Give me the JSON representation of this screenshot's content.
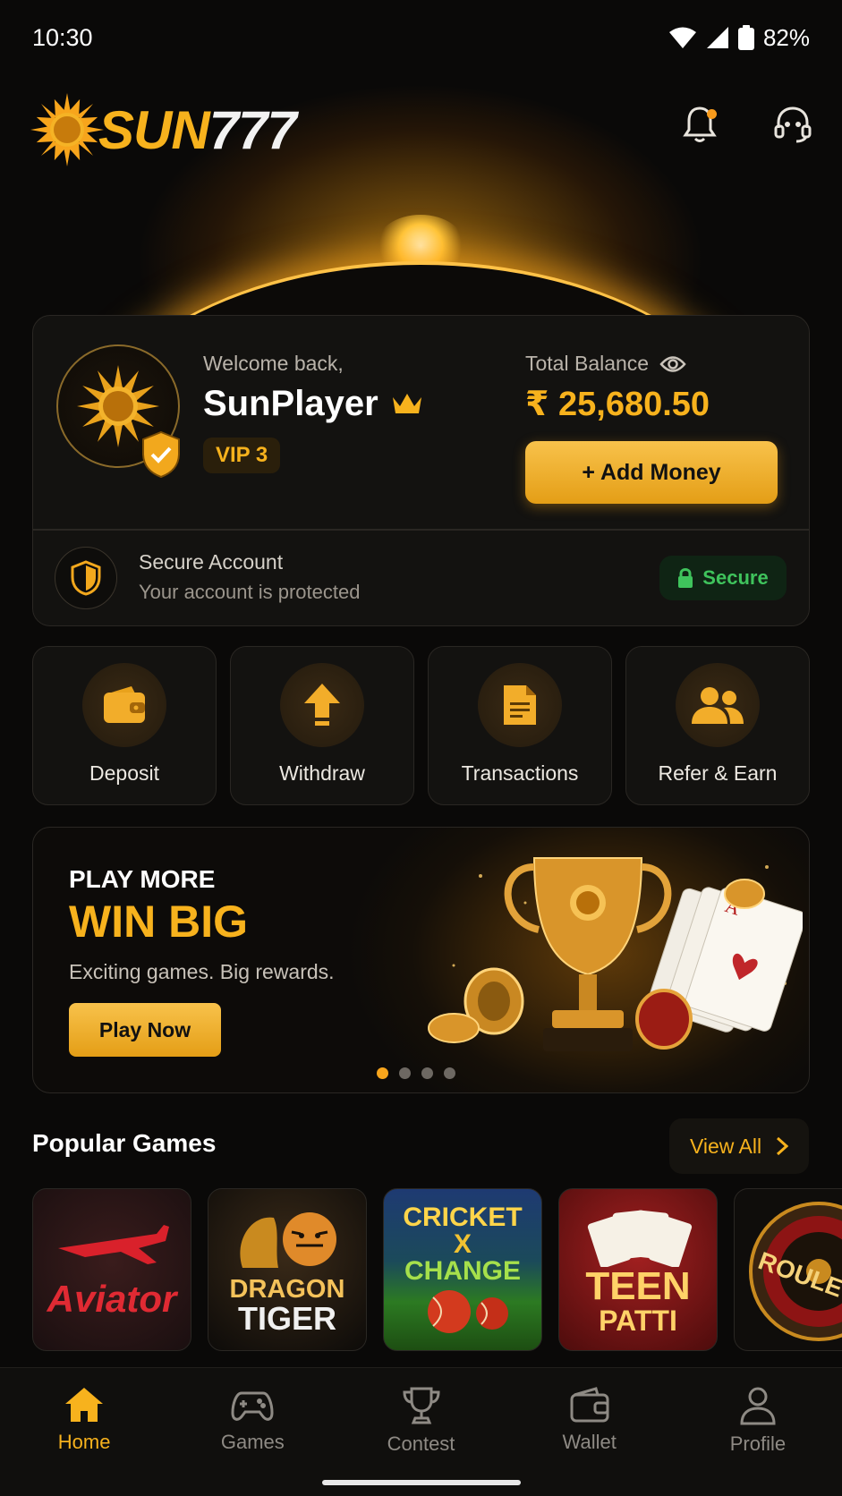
{
  "status_bar": {
    "time": "10:30",
    "battery": "82%"
  },
  "brand": {
    "name_part1": "SUN",
    "name_part2": "777"
  },
  "account": {
    "welcome": "Welcome back,",
    "username": "SunPlayer",
    "vip": "VIP 3",
    "balance_label": "Total Balance",
    "balance": "₹ 25,680.50",
    "add_money": "+ Add Money"
  },
  "security": {
    "title": "Secure Account",
    "subtitle": "Your account is protected",
    "badge": "Secure"
  },
  "quick_actions": [
    {
      "label": "Deposit",
      "icon": "wallet-icon"
    },
    {
      "label": "Withdraw",
      "icon": "arrow-up-icon"
    },
    {
      "label": "Transactions",
      "icon": "document-icon"
    },
    {
      "label": "Refer & Earn",
      "icon": "users-icon"
    }
  ],
  "banner": {
    "line1": "PLAY MORE",
    "line2": "WIN BIG",
    "line3": "Exciting games. Big rewards.",
    "cta": "Play Now",
    "slides": 4,
    "active_slide": 1
  },
  "popular_games": {
    "title": "Popular Games",
    "view_all": "View All",
    "items": [
      {
        "name": "Aviator"
      },
      {
        "name_top": "DRAGON",
        "name_bottom": "TIGER"
      },
      {
        "line1": "CRICKET",
        "line2": "X",
        "line3": "CHANGE"
      },
      {
        "line1": "TEEN",
        "line2": "PATTI"
      },
      {
        "name": "ROULETTE"
      }
    ]
  },
  "nav": [
    {
      "label": "Home",
      "icon": "home-icon",
      "active": true
    },
    {
      "label": "Games",
      "icon": "gamepad-icon",
      "active": false
    },
    {
      "label": "Contest",
      "icon": "trophy-icon",
      "active": false
    },
    {
      "label": "Wallet",
      "icon": "wallet-icon",
      "active": false
    },
    {
      "label": "Profile",
      "icon": "profile-icon",
      "active": false
    }
  ],
  "colors": {
    "accent": "#f7b21d",
    "background": "#0a0908",
    "card": "#131210",
    "secure_green": "#3fc35c"
  }
}
